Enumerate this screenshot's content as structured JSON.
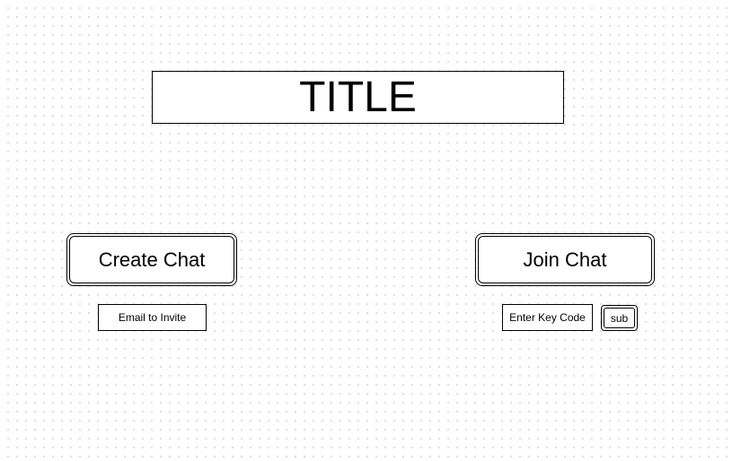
{
  "title": "TITLE",
  "create_section": {
    "button_label": "Create Chat",
    "email_field_text": "Email to Invite"
  },
  "join_section": {
    "button_label": "Join Chat",
    "key_field_text": "Enter Key Code",
    "submit_label": "sub"
  }
}
